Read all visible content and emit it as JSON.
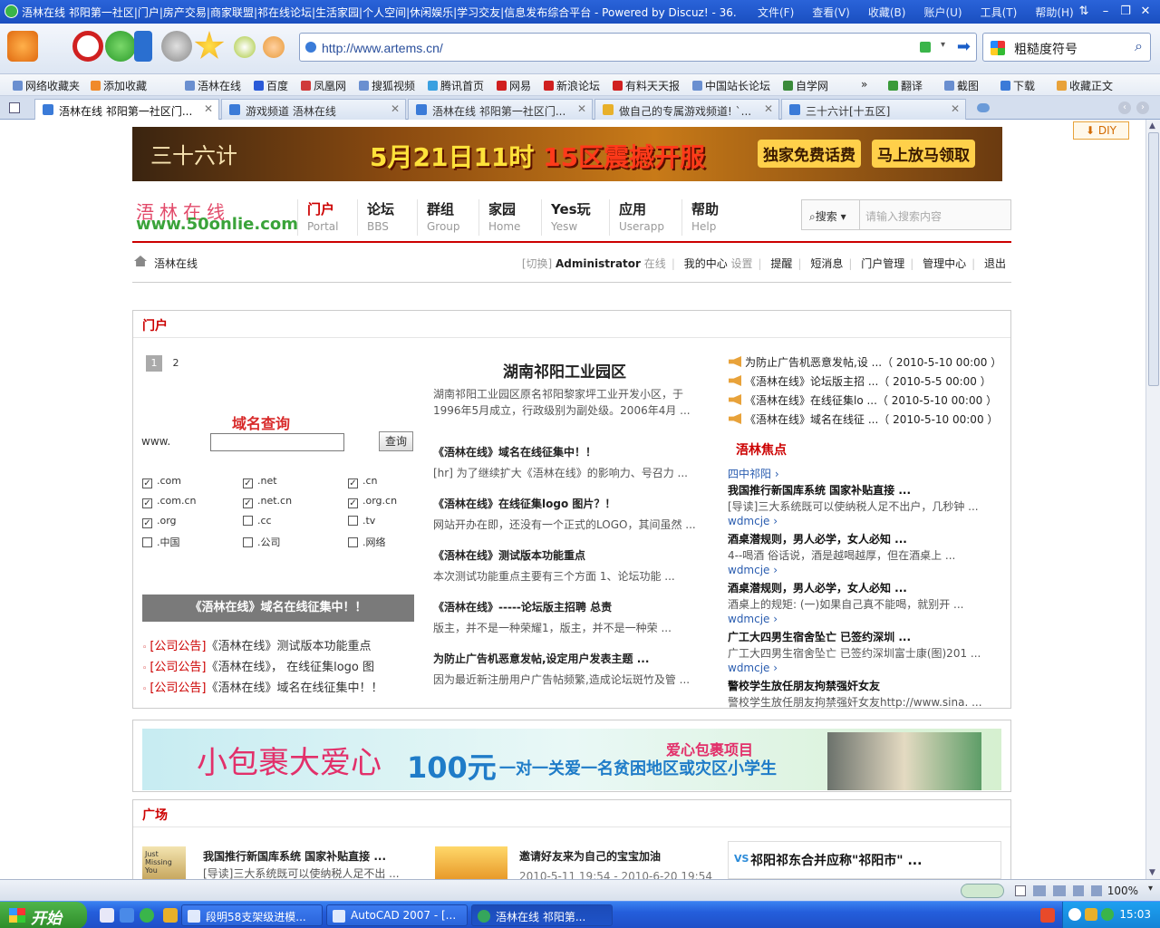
{
  "window": {
    "title": "浯林在线 祁阳第一社区|门户|房产交易|商家联盟|祁在线论坛|生活家园|个人空间|休闲娱乐|学习交友|信息发布综合平台 - Powered by Discuz! - 36...",
    "menu": [
      "文件(F)",
      "查看(V)",
      "收藏(B)",
      "账户(U)",
      "工具(T)",
      "帮助(H)"
    ]
  },
  "address": {
    "url": "http://www.artems.cn/"
  },
  "search_engine": {
    "label": "粗糙度符号"
  },
  "favorites": [
    "网络收藏夹",
    "添加收藏",
    "浯林在线",
    "百度",
    "凤凰网",
    "搜狐视频",
    "腾讯首页",
    "网易",
    "新浪论坛",
    "有料天天报",
    "中国站长论坛",
    "自学网",
    "»",
    "翻译",
    "截图",
    "下载",
    "收藏正文"
  ],
  "tabs": [
    {
      "label": "浯林在线 祁阳第一社区门..."
    },
    {
      "label": "游戏频道 浯林在线"
    },
    {
      "label": "浯林在线 祁阳第一社区门..."
    },
    {
      "label": "做自己的专属游戏频道! `..."
    },
    {
      "label": "三十六计[十五区]"
    }
  ],
  "diy": "DIY",
  "top_banner": {
    "logo": "三十六计",
    "main_a": "5月21日11时 ",
    "main_b": "15区震撼开服",
    "side_a": "独家免费话费",
    "side_b": "马上放马领取"
  },
  "site": {
    "logo_cn": "浯林在线",
    "logo_url": "www.50onlie.com"
  },
  "nav": [
    {
      "cn": "门户",
      "en": "Portal"
    },
    {
      "cn": "论坛",
      "en": "BBS"
    },
    {
      "cn": "群组",
      "en": "Group"
    },
    {
      "cn": "家园",
      "en": "Home"
    },
    {
      "cn": "Yes玩",
      "en": "Yesw"
    },
    {
      "cn": "应用",
      "en": "Userapp"
    },
    {
      "cn": "帮助",
      "en": "Help"
    }
  ],
  "site_search": {
    "select": "搜索",
    "placeholder": "请输入搜索内容"
  },
  "breadcrumb": {
    "home": "浯林在线"
  },
  "userbar": {
    "switch": "[切换]",
    "user": "Administrator",
    "status": "在线",
    "center": "我的中心",
    "settings": "设置",
    "links": [
      "提醒",
      "短消息",
      "门户管理",
      "管理中心",
      "退出"
    ]
  },
  "portal": {
    "heading": "门户",
    "pager": [
      "1",
      "2"
    ],
    "domain": {
      "title": "域名查询",
      "prefix": "www.",
      "button": "查询",
      "options": [
        {
          "label": ".com",
          "checked": true
        },
        {
          "label": ".net",
          "checked": true
        },
        {
          "label": ".cn",
          "checked": true
        },
        {
          "label": ".com.cn",
          "checked": true
        },
        {
          "label": ".net.cn",
          "checked": true
        },
        {
          "label": ".org.cn",
          "checked": true
        },
        {
          "label": ".org",
          "checked": true
        },
        {
          "label": ".cc",
          "checked": false
        },
        {
          "label": ".tv",
          "checked": false
        },
        {
          "label": ".中国",
          "checked": false
        },
        {
          "label": ".公司",
          "checked": false
        },
        {
          "label": ".网络",
          "checked": false
        }
      ]
    },
    "gray_banner": "《浯林在线》域名在线征集中！！",
    "notices": [
      {
        "cat": "[公司公告]",
        "text": "《浯林在线》测试版本功能重点"
      },
      {
        "cat": "[公司公告]",
        "text": "《浯林在线》， 在线征集logo 图"
      },
      {
        "cat": "[公司公告]",
        "text": "《浯林在线》域名在线征集中！！"
      }
    ],
    "main": {
      "headline": "湖南祁阳工业园区",
      "summary": "湖南祁阳工业园区原名祁阳黎家坪工业开发小区，于1996年5月成立，行政级别为副处级。2006年4月 ...",
      "items": [
        {
          "title": "《浯林在线》域名在线征集中！！",
          "text": "[hr] 为了继续扩大《浯林在线》的影响力、号召力 ..."
        },
        {
          "title": "《浯林在线》在线征集logo 图片？！",
          "text": "网站开办在即，还没有一个正式的LOGO，其间虽然 ..."
        },
        {
          "title": "《浯林在线》测试版本功能重点",
          "text": "本次测试功能重点主要有三个方面 1、论坛功能 ..."
        },
        {
          "title": "《浯林在线》-----论坛版主招聘 总责",
          "text": "版主，并不是一种荣耀1，版主，并不是一种荣 ..."
        },
        {
          "title": "为防止广告机恶意发帖,设定用户发表主题 ...",
          "text": "因为最近新注册用户广告帖频繁,造成论坛斑竹及管 ..."
        }
      ]
    },
    "announcements": [
      "为防止广告机恶意发帖,设 ...（ 2010-5-10 00:00 ）",
      "《浯林在线》论坛版主招 ...（ 2010-5-5 00:00 ）",
      "《浯林在线》在线征集lo ...（ 2010-5-10 00:00 ）",
      "《浯林在线》域名在线征 ...（ 2010-5-10 00:00 ）"
    ],
    "focus": {
      "heading": "浯林焦点",
      "items": [
        {
          "link": "四中祁阳 ›",
          "title": "我国推行新国库系统 国家补贴直接 ...",
          "text": "[导读]三大系统既可以使纳税人足不出户，几秒钟 ..."
        },
        {
          "link": "wdmcje ›",
          "title": "酒桌潜规则，男人必学，女人必知 ...",
          "text": "4--喝酒 俗话说，酒是越喝越厚，但在酒桌上 ..."
        },
        {
          "link": "wdmcje ›",
          "title": "酒桌潜规则，男人必学，女人必知 ...",
          "text": "酒桌上的规矩: (一)如果自己真不能喝，就别开 ..."
        },
        {
          "link": "wdmcje ›",
          "title": "广工大四男生宿舍坠亡 已签约深圳 ...",
          "text": "广工大四男生宿舍坠亡 已签约深圳富士康(图)201 ..."
        },
        {
          "link": "wdmcje ›",
          "title": "警校学生放任朋友拘禁强奸女友",
          "text": "警校学生放任朋友拘禁强奸女友http://www.sina. ..."
        }
      ]
    }
  },
  "charity_banner": {
    "a": "小包裹大爱心",
    "b": "100元",
    "c": "一对一关爱一名贫困地区或灾区小学生",
    "d": "爱心包裹项目"
  },
  "plaza": {
    "heading": "广场",
    "thumb_text": "Just Missing You",
    "item1": {
      "title": "我国推行新国库系统 国家补贴直接 ...",
      "text": "[导读]三大系统既可以使纳税人足不出 ..."
    },
    "item2": {
      "title": "邀请好友来为自己的宝宝加油",
      "text": "2010-5-11 19:54 - 2010-6-20 19:54"
    },
    "vs": {
      "tag": "VS",
      "title": "祁阳祁东合并应称\"祁阳市\" ..."
    }
  },
  "status": {
    "zoom": "100%"
  },
  "taskbar": {
    "start": "开始",
    "tasks": [
      "段明58支架级进模...",
      "AutoCAD 2007 - [...",
      "浯林在线 祁阳第..."
    ],
    "clock": "15:03"
  }
}
